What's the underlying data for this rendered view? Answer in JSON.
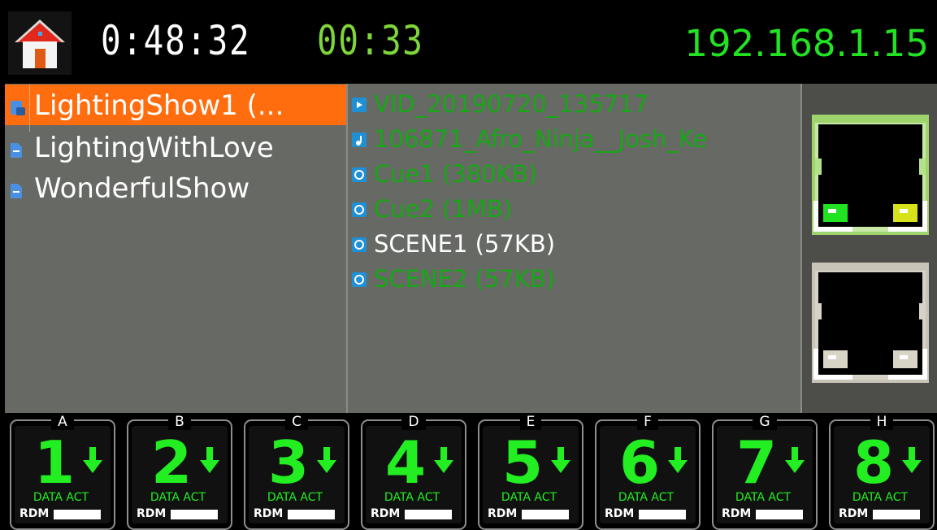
{
  "header": {
    "home_icon": "home-icon",
    "elapsed_time": "0:48:32",
    "remaining_time": "00:33",
    "ip_address": "192.168.1.15"
  },
  "shows": [
    {
      "label": "LightingShow1 (...",
      "icon": "show-folder-icon",
      "selected": true
    },
    {
      "label": "LightingWithLove",
      "icon": "document-icon",
      "selected": false
    },
    {
      "label": "WonderfulShow",
      "icon": "document-icon",
      "selected": false
    }
  ],
  "files": [
    {
      "label": "VID_20190720_135717",
      "icon": "video-icon",
      "color": "#17a717"
    },
    {
      "label": "106871_Afro_Ninja__Josh_Ke",
      "icon": "audio-icon",
      "color": "#17a717"
    },
    {
      "label": "Cue1 (380KB)",
      "icon": "cue-icon",
      "color": "#17a717"
    },
    {
      "label": "Cue2 (1MB)",
      "icon": "cue-icon",
      "color": "#17a717"
    },
    {
      "label": "SCENE1 (57KB)",
      "icon": "cue-icon",
      "color": "#ffffff"
    },
    {
      "label": "SCENE2 (57KB)",
      "icon": "cue-icon",
      "color": "#17a717"
    }
  ],
  "network_ports": [
    {
      "name": "ethernet-port-1",
      "state": "active"
    },
    {
      "name": "ethernet-port-2",
      "state": "inactive"
    }
  ],
  "universes": [
    {
      "letter": "A",
      "number": "1",
      "status": "DATA ACT",
      "rdm_label": "RDM"
    },
    {
      "letter": "B",
      "number": "2",
      "status": "DATA ACT",
      "rdm_label": "RDM"
    },
    {
      "letter": "C",
      "number": "3",
      "status": "DATA ACT",
      "rdm_label": "RDM"
    },
    {
      "letter": "D",
      "number": "4",
      "status": "DATA ACT",
      "rdm_label": "RDM"
    },
    {
      "letter": "E",
      "number": "5",
      "status": "DATA ACT",
      "rdm_label": "RDM"
    },
    {
      "letter": "F",
      "number": "6",
      "status": "DATA ACT",
      "rdm_label": "RDM"
    },
    {
      "letter": "G",
      "number": "7",
      "status": "DATA ACT",
      "rdm_label": "RDM"
    },
    {
      "letter": "H",
      "number": "8",
      "status": "DATA ACT",
      "rdm_label": "RDM"
    }
  ],
  "colors": {
    "accent": "#ff6d0f",
    "green": "#22ee22",
    "panel": "#676964"
  }
}
